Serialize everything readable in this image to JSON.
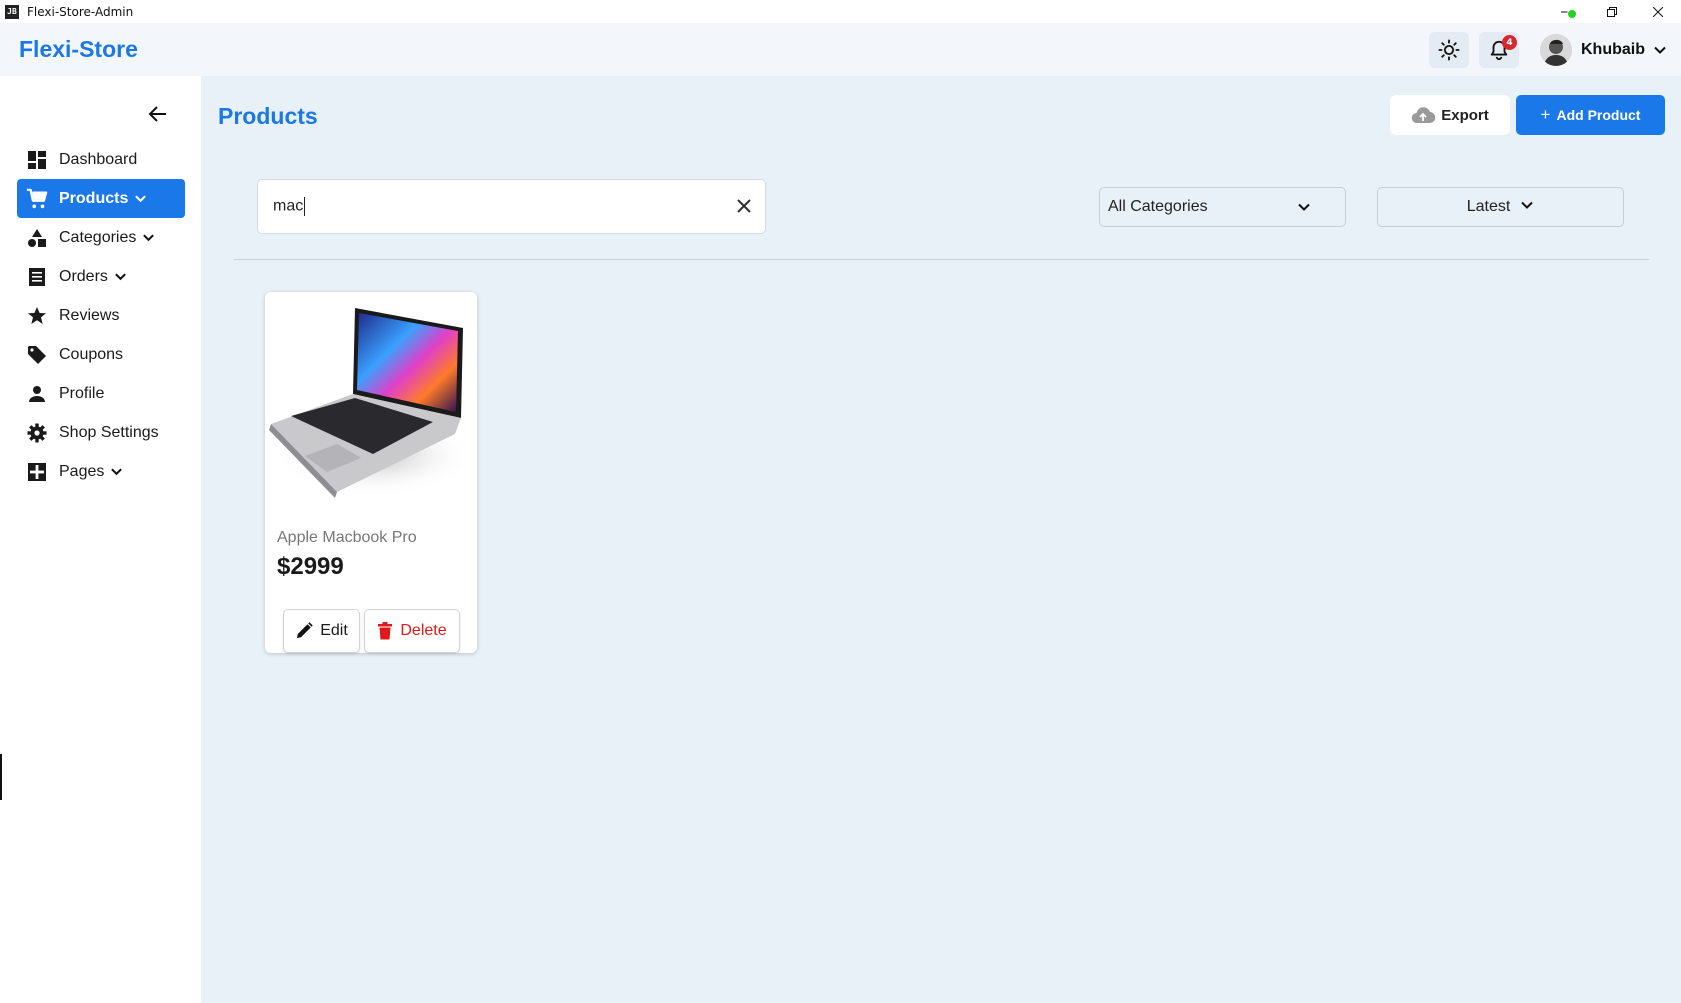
{
  "window": {
    "title": "Flexi-Store-Admin",
    "icon_text": "JB"
  },
  "header": {
    "brand": "Flexi-Store",
    "notifications": {
      "count": "4"
    },
    "user": {
      "name": "Khubaib",
      "online": true
    }
  },
  "sidebar": {
    "items": [
      {
        "label": "Dashboard",
        "icon": "dashboard-icon",
        "expandable": false,
        "active": false
      },
      {
        "label": "Products",
        "icon": "cart-icon",
        "expandable": true,
        "active": true
      },
      {
        "label": "Categories",
        "icon": "shapes-icon",
        "expandable": true,
        "active": false
      },
      {
        "label": "Orders",
        "icon": "list-icon",
        "expandable": true,
        "active": false
      },
      {
        "label": "Reviews",
        "icon": "star-icon",
        "expandable": false,
        "active": false
      },
      {
        "label": "Coupons",
        "icon": "tag-icon",
        "expandable": false,
        "active": false
      },
      {
        "label": "Profile",
        "icon": "person-icon",
        "expandable": false,
        "active": false
      },
      {
        "label": "Shop Settings",
        "icon": "gear-icon",
        "expandable": false,
        "active": false
      },
      {
        "label": "Pages",
        "icon": "pages-icon",
        "expandable": true,
        "active": false
      }
    ]
  },
  "main": {
    "title": "Products",
    "export_label": "Export",
    "add_label": "Add Product",
    "search": {
      "value": "mac"
    },
    "category_filter": {
      "selected": "All Categories"
    },
    "sort_filter": {
      "selected": "Latest"
    },
    "products": [
      {
        "name": "Apple Macbook Pro",
        "price": "$2999",
        "edit_label": "Edit",
        "delete_label": "Delete"
      }
    ]
  },
  "colors": {
    "accent": "#1a78e8",
    "danger": "#e01818",
    "background": "#e8f0f8",
    "badge": "#d7262c",
    "online": "#24d224"
  }
}
